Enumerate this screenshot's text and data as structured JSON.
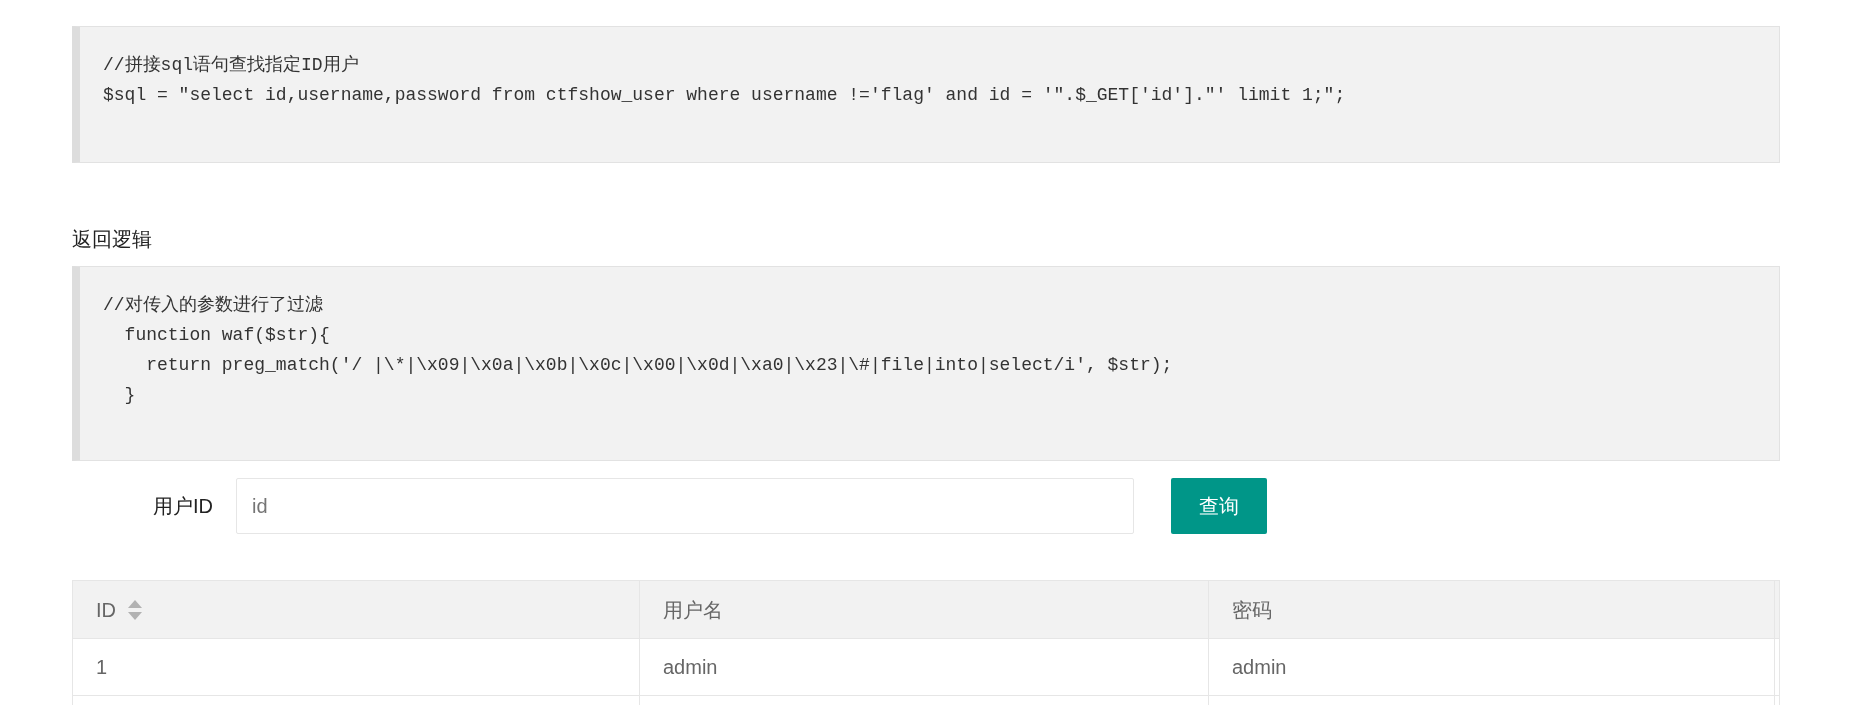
{
  "query_code": {
    "lines": [
      "//拼接sql语句查找指定ID用户",
      "$sql = \"select id,username,password from ctfshow_user where username !='flag' and id = '\".$_GET['id'].\"' limit 1;\";"
    ]
  },
  "return_logic": {
    "heading": "返回逻辑",
    "lines": [
      "//对传入的参数进行了过滤",
      "  function waf($str){",
      "    return preg_match('/ |\\*|\\x09|\\x0a|\\x0b|\\x0c|\\x00|\\x0d|\\xa0|\\x23|\\#|file|into|select/i', $str);",
      "  }"
    ]
  },
  "form": {
    "label": "用户ID",
    "input": {
      "placeholder": "id"
    },
    "button": "查询"
  },
  "table": {
    "columns": [
      {
        "label": "ID",
        "sortable": true
      },
      {
        "label": "用户名",
        "sortable": false
      },
      {
        "label": "密码",
        "sortable": false
      }
    ],
    "rows": [
      [
        "1",
        "admin",
        "admin"
      ]
    ]
  }
}
